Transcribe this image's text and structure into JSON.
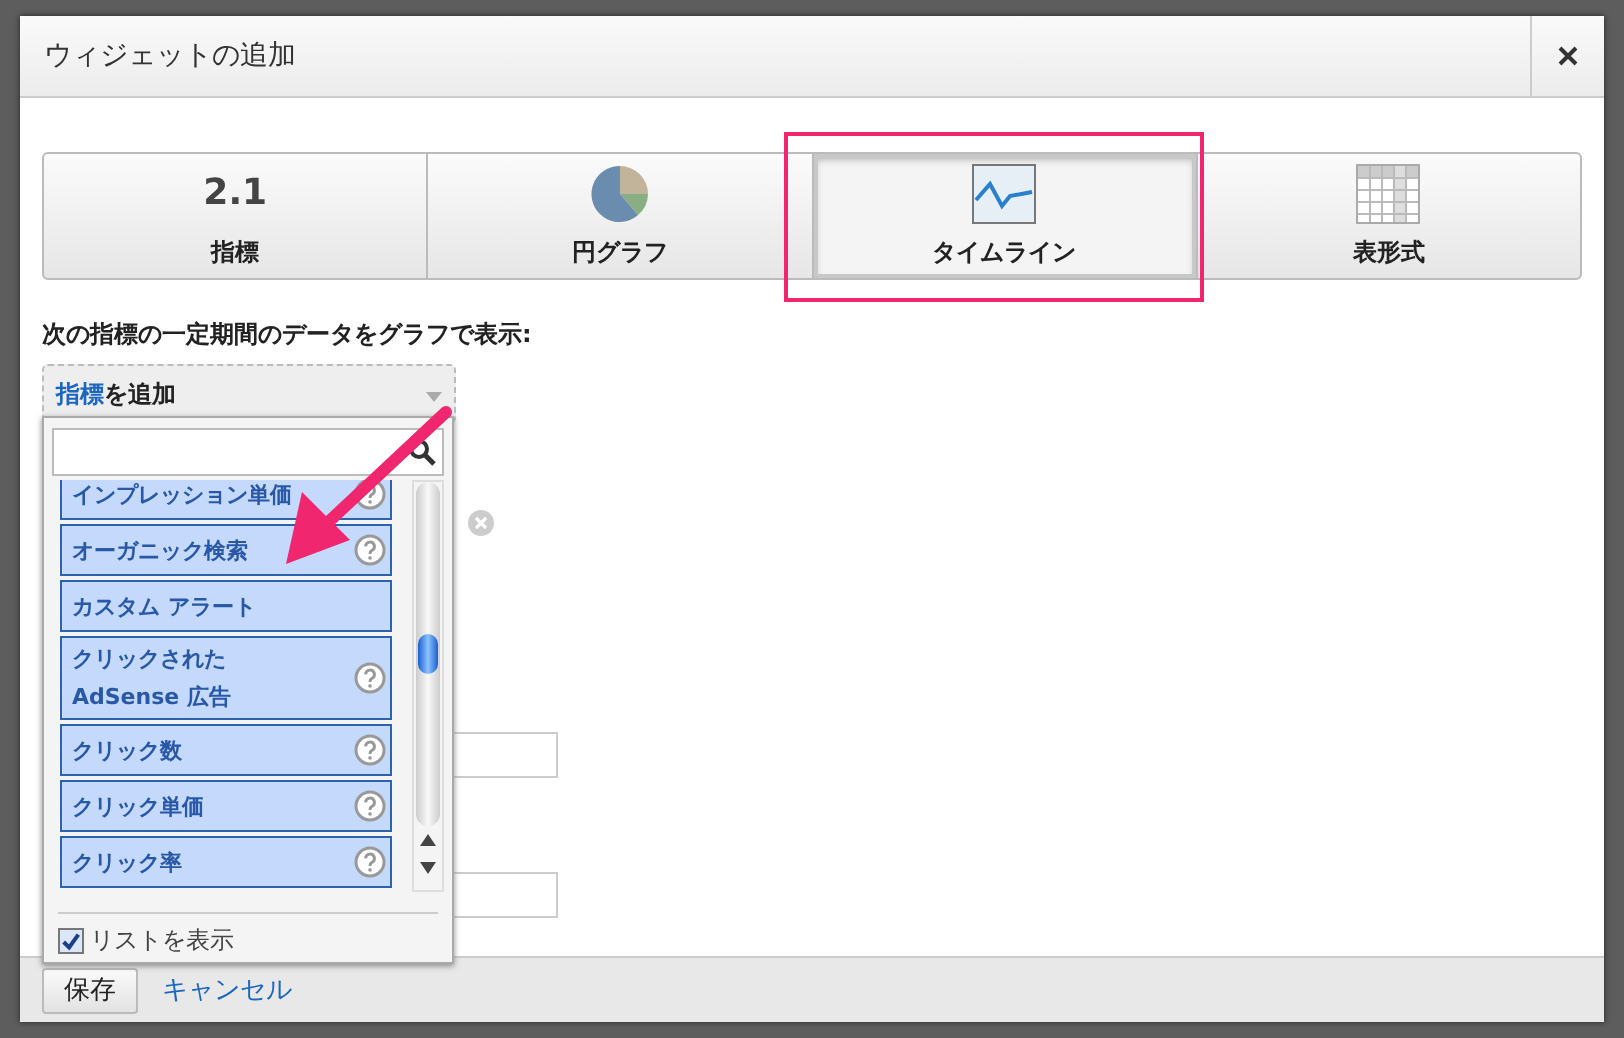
{
  "window": {
    "title": "ウィジェットの追加"
  },
  "tabs": [
    {
      "kind": "metric",
      "icon_text": "2.1",
      "label": "指標",
      "selected": false
    },
    {
      "kind": "pie",
      "label": "円グラフ",
      "selected": false
    },
    {
      "kind": "timeline",
      "label": "タイムライン",
      "selected": true
    },
    {
      "kind": "table",
      "label": "表形式",
      "selected": false
    }
  ],
  "instruction": "次の指標の一定期間のデータをグラフで表示:",
  "metric_select": {
    "link": "指標",
    "text": "を追加"
  },
  "metric_list": {
    "items": [
      {
        "label": "インプレッション単価",
        "help": true
      },
      {
        "label": "オーガニック検索",
        "help": true
      },
      {
        "label": "カスタム アラート",
        "help": false
      },
      {
        "label": "クリックされた AdSense 広告",
        "help": true
      },
      {
        "label": "クリック数",
        "help": true
      },
      {
        "label": "クリック単価",
        "help": true
      },
      {
        "label": "クリック率",
        "help": true
      }
    ],
    "show_list": {
      "label": "リストを表示",
      "checked": true
    }
  },
  "footer": {
    "save": "保存",
    "cancel": "キャンセル"
  }
}
